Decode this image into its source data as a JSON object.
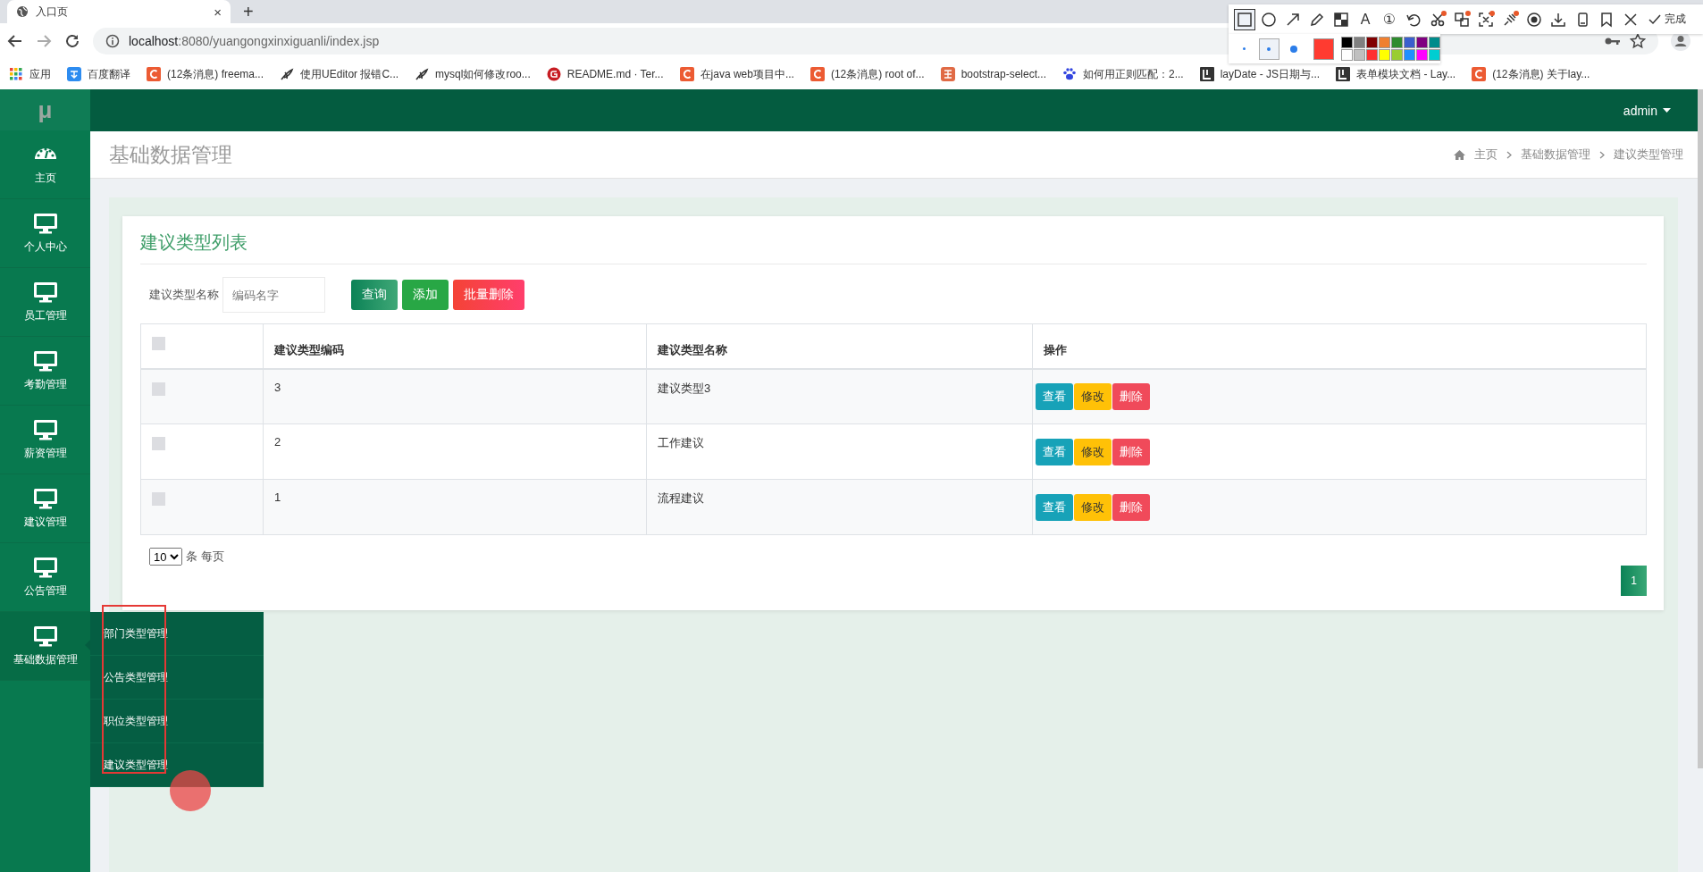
{
  "browser": {
    "tab": {
      "title": "入口页",
      "close": "×"
    },
    "new_tab": "+",
    "url": {
      "host": "localhost",
      "path": ":8080/yuangongxinxiguanli/index.jsp"
    },
    "bookmarks": [
      {
        "kind": "apps",
        "title": "应用"
      },
      {
        "kind": "translate",
        "title": "百度翻译"
      },
      {
        "kind": "csdn",
        "title": "(12条消息) freema..."
      },
      {
        "kind": "feather",
        "title": "使用UEditor 报错C..."
      },
      {
        "kind": "feather",
        "title": "mysql如何修改roo..."
      },
      {
        "kind": "gitee",
        "title": "README.md · Ter..."
      },
      {
        "kind": "csdn",
        "title": "在java web项目中..."
      },
      {
        "kind": "csdn",
        "title": "(12条消息) root of..."
      },
      {
        "kind": "jian",
        "title": "bootstrap-select..."
      },
      {
        "kind": "paw",
        "title": "如何用正则匹配：2..."
      },
      {
        "kind": "layui",
        "title": "layDate - JS日期与..."
      },
      {
        "kind": "layui",
        "title": "表单模块文档 - Lay..."
      },
      {
        "kind": "csdn",
        "title": "(12条消息) 关于lay..."
      }
    ]
  },
  "capture_toolbar": {
    "tools": [
      {
        "kind": "rectangle",
        "selected": true
      },
      {
        "kind": "ellipse",
        "selected": false
      },
      {
        "kind": "arrow",
        "selected": false
      },
      {
        "kind": "pen",
        "selected": false
      },
      {
        "kind": "mosaic",
        "selected": false
      },
      {
        "kind": "text",
        "glyph": "A",
        "selected": false
      },
      {
        "kind": "number",
        "glyph": "①",
        "selected": false
      },
      {
        "kind": "undo",
        "selected": false
      },
      {
        "kind": "scissors",
        "selected": false,
        "badge": true
      },
      {
        "kind": "translate",
        "selected": false,
        "badge": true
      },
      {
        "kind": "frame",
        "selected": false,
        "badge": true
      },
      {
        "kind": "pin",
        "selected": false,
        "badge": true
      },
      {
        "kind": "record",
        "selected": false
      },
      {
        "kind": "download",
        "selected": false
      },
      {
        "kind": "phone",
        "selected": false
      },
      {
        "kind": "bookmark",
        "selected": false
      },
      {
        "kind": "close",
        "selected": false
      }
    ],
    "done_label": "完成",
    "sizes": [
      {
        "selected": false
      },
      {
        "selected": true
      },
      {
        "selected": false
      }
    ],
    "current": {
      "color": "#ff3b30"
    },
    "palette": [
      {
        "color": "#000000"
      },
      {
        "color": "#808080"
      },
      {
        "color": "#800000"
      },
      {
        "color": "#f08030"
      },
      {
        "color": "#2e8b2e"
      },
      {
        "color": "#3a5fcd"
      },
      {
        "color": "#800080"
      },
      {
        "color": "#008b8b"
      },
      {
        "color": "#ffffff"
      },
      {
        "color": "#c0c0c0"
      },
      {
        "color": "#ff3030"
      },
      {
        "color": "#ffff00"
      },
      {
        "color": "#9acd32"
      },
      {
        "color": "#1e90ff"
      },
      {
        "color": "#ff00ff"
      },
      {
        "color": "#00ced1"
      }
    ]
  },
  "app": {
    "logo": "μ",
    "user": "admin",
    "sidebar": [
      {
        "kind": "home",
        "label": "主页",
        "selected": false
      },
      {
        "kind": "module",
        "label": "个人中心",
        "selected": false
      },
      {
        "kind": "module",
        "label": "员工管理",
        "selected": false
      },
      {
        "kind": "module",
        "label": "考勤管理",
        "selected": false
      },
      {
        "kind": "module",
        "label": "薪资管理",
        "selected": false
      },
      {
        "kind": "module",
        "label": "建议管理",
        "selected": false
      },
      {
        "kind": "module",
        "label": "公告管理",
        "selected": false
      },
      {
        "kind": "module",
        "label": "基础数据管理",
        "selected": true,
        "children": [
          {
            "label": "部门类型管理"
          },
          {
            "label": "公告类型管理"
          },
          {
            "label": "职位类型管理"
          },
          {
            "label": "建议类型管理"
          }
        ]
      }
    ],
    "page_title": "基础数据管理",
    "breadcrumb": [
      "主页",
      "基础数据管理",
      "建议类型管理"
    ],
    "card_title": "建议类型列表",
    "search": {
      "label": "建议类型名称",
      "placeholder": "编码名字"
    },
    "actions": [
      {
        "kind": "query",
        "label": "查询"
      },
      {
        "kind": "add",
        "label": "添加"
      },
      {
        "kind": "bulk_delete",
        "label": "批量删除"
      }
    ],
    "table": {
      "select_all": {
        "checked": false
      },
      "columns": [
        "建议类型编码",
        "建议类型名称",
        "操作"
      ],
      "rows": [
        {
          "checked": false,
          "cells": [
            "3",
            "建议类型3"
          ],
          "buttons": [
            {
              "kind": "view",
              "label": "查看"
            },
            {
              "kind": "edit",
              "label": "修改"
            },
            {
              "kind": "delete",
              "label": "删除"
            }
          ]
        },
        {
          "checked": false,
          "cells": [
            "2",
            "工作建议"
          ],
          "buttons": [
            {
              "kind": "view",
              "label": "查看"
            },
            {
              "kind": "edit",
              "label": "修改"
            },
            {
              "kind": "delete",
              "label": "删除"
            }
          ]
        },
        {
          "checked": false,
          "cells": [
            "1",
            "流程建议"
          ],
          "buttons": [
            {
              "kind": "view",
              "label": "查看"
            },
            {
              "kind": "edit",
              "label": "修改"
            },
            {
              "kind": "delete",
              "label": "删除"
            }
          ]
        }
      ]
    },
    "page_size": {
      "value": "10",
      "suffix": "条 每页"
    },
    "pagination": [
      {
        "label": "1",
        "selected": true
      }
    ]
  }
}
